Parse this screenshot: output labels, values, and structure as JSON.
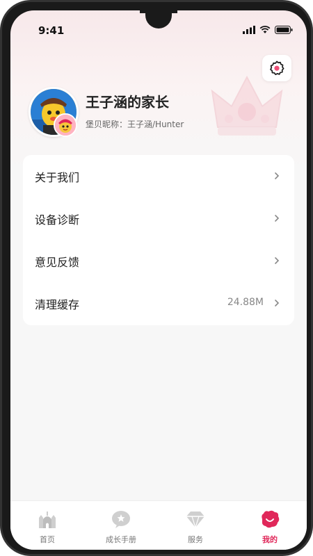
{
  "status_bar": {
    "time": "9:41"
  },
  "profile": {
    "parent_name": "王子涵的家长",
    "nickname_text": "堡贝昵称：王子涵/Hunter"
  },
  "menu": {
    "items": [
      {
        "label": "关于我们",
        "value": ""
      },
      {
        "label": "设备诊断",
        "value": ""
      },
      {
        "label": "意见反馈",
        "value": ""
      },
      {
        "label": "清理缓存",
        "value": "24.88M"
      }
    ]
  },
  "tabbar": {
    "active_color": "#e0285a",
    "items": [
      {
        "label": "首页",
        "icon": "castle-icon",
        "active": false
      },
      {
        "label": "成长手册",
        "icon": "handbook-icon",
        "active": false
      },
      {
        "label": "服务",
        "icon": "diamond-icon",
        "active": false
      },
      {
        "label": "我的",
        "icon": "smiley-icon",
        "active": true
      }
    ]
  }
}
